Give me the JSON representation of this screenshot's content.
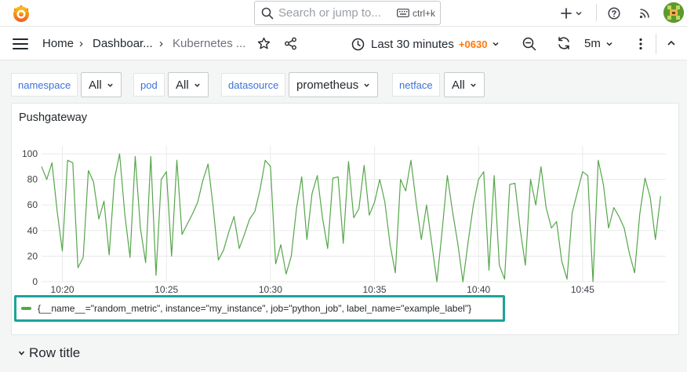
{
  "topbar": {
    "search_placeholder": "Search or jump to...",
    "search_shortcut": "ctrl+k",
    "icons": [
      "grafana-logo-icon",
      "search-icon",
      "keyboard-icon",
      "plus-icon",
      "chevron-down-icon",
      "help-icon",
      "rss-icon",
      "avatar"
    ]
  },
  "breadcrumb": {
    "items": [
      "Home",
      "Dashboar...",
      "Kubernetes ..."
    ],
    "separator": "›"
  },
  "time_picker": {
    "range": "Last 30 minutes",
    "timezone": "+0630",
    "refresh_interval": "5m"
  },
  "variables": [
    {
      "label": "namespace",
      "value": "All"
    },
    {
      "label": "pod",
      "value": "All"
    },
    {
      "label": "datasource",
      "value": "prometheus"
    },
    {
      "label": "netface",
      "value": "All"
    }
  ],
  "panel": {
    "title": "Pushgateway",
    "legend": "{__name__=\"random_metric\", instance=\"my_instance\", job=\"python_job\", label_name=\"example_label\"}"
  },
  "row": {
    "title": "Row title"
  },
  "colors": {
    "series": "#56a64b",
    "legend_highlight": "#1ba39c",
    "timezone": "#ff780a",
    "variable_label": "#3d71d9"
  },
  "chart_data": {
    "type": "line",
    "title": "Pushgateway",
    "xlabel": "",
    "ylabel": "",
    "xlim": [
      "10:19",
      "10:49"
    ],
    "ylim": [
      0,
      100
    ],
    "y_ticks": [
      "0",
      "20",
      "40",
      "60",
      "80",
      "100"
    ],
    "x_ticks": [
      "10:20",
      "10:25",
      "10:30",
      "10:35",
      "10:40",
      "10:45"
    ],
    "grid": true,
    "legend_position": "bottom-left",
    "series": [
      {
        "name": "{__name__=\"random_metric\", instance=\"my_instance\", job=\"python_job\", label_name=\"example_label\"}",
        "x_minutes_after_1019": [
          0,
          0.25,
          0.5,
          0.75,
          1.0,
          1.25,
          1.5,
          1.75,
          2.0,
          2.25,
          2.5,
          2.75,
          3.0,
          3.25,
          3.5,
          3.75,
          4.0,
          4.25,
          4.5,
          4.75,
          5.0,
          5.25,
          5.5,
          5.75,
          6.0,
          6.25,
          6.5,
          6.75,
          7.0,
          7.25,
          7.5,
          7.75,
          8.0,
          8.25,
          8.5,
          8.75,
          9.0,
          9.25,
          9.5,
          9.75,
          10.0,
          10.25,
          10.5,
          10.75,
          11.0,
          11.25,
          11.5,
          11.75,
          12.0,
          12.25,
          12.5,
          12.75,
          13.0,
          13.25,
          13.5,
          13.75,
          14.0,
          14.25,
          14.5,
          14.75,
          15.0,
          15.25,
          15.5,
          15.75,
          16.0,
          16.25,
          16.5,
          16.75,
          17.0,
          17.25,
          17.5,
          17.75,
          18.0,
          18.25,
          18.5,
          18.75,
          19.0,
          19.25,
          19.5,
          19.75,
          20.0,
          20.25,
          20.5,
          20.75,
          21.0,
          21.25,
          21.5,
          21.75,
          22.0,
          22.25,
          22.5,
          22.75,
          23.0,
          23.25,
          23.5,
          23.75,
          24.0,
          24.25,
          24.5,
          24.75,
          25.0,
          25.25,
          25.5,
          25.75,
          26.0,
          26.25,
          26.5,
          26.75,
          27.0,
          27.25,
          27.5,
          27.75,
          28.0,
          28.25,
          28.5,
          28.75,
          29.0,
          29.25,
          29.5,
          29.75
        ],
        "values": [
          90,
          80,
          93,
          55,
          24,
          95,
          93,
          11,
          19,
          87,
          78,
          49,
          63,
          21,
          80,
          100,
          53,
          19,
          98,
          42,
          15,
          98,
          5,
          80,
          86,
          20,
          95,
          37,
          45,
          53,
          62,
          79,
          92,
          58,
          17,
          25,
          39,
          51,
          26,
          37,
          49,
          55,
          72,
          95,
          90,
          14,
          29,
          6,
          20,
          57,
          82,
          33,
          69,
          83,
          50,
          26,
          81,
          82,
          30,
          94,
          50,
          57,
          91,
          52,
          62,
          80,
          62,
          29,
          7,
          80,
          71,
          95,
          62,
          33,
          60,
          30,
          0,
          40,
          83,
          55,
          30,
          0,
          31,
          60,
          80,
          86,
          9,
          83,
          13,
          2,
          76,
          77,
          41,
          13,
          80,
          60,
          90,
          58,
          42,
          47,
          16,
          2,
          54,
          70,
          86,
          83,
          0,
          95,
          76,
          42,
          58,
          51,
          42,
          22,
          7,
          53,
          81,
          66,
          33,
          67
        ]
      }
    ]
  }
}
